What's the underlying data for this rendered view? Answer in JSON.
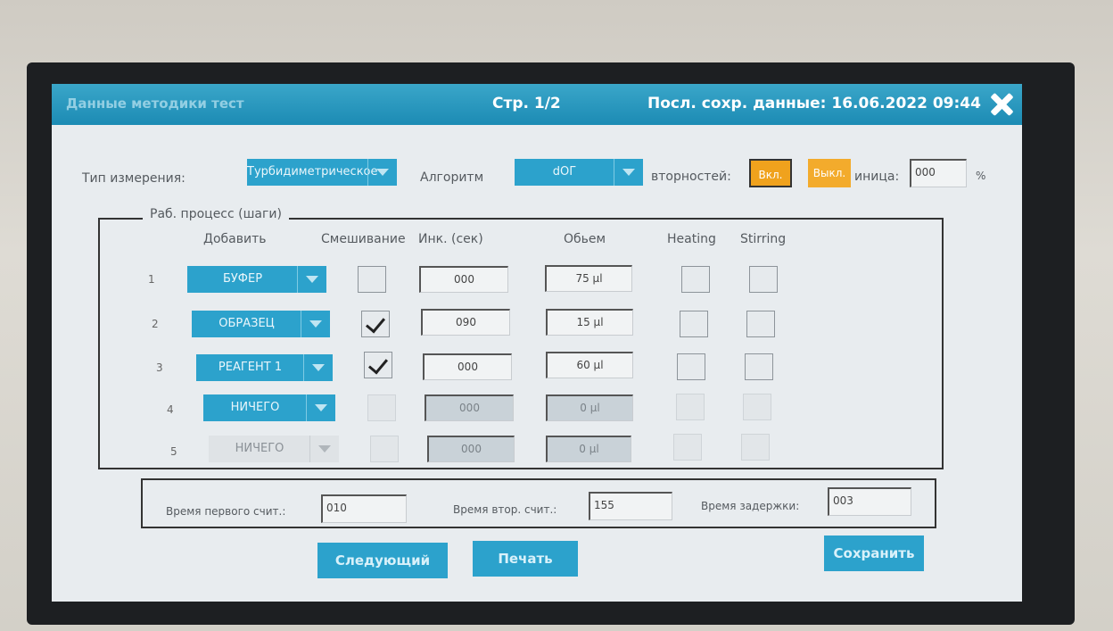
{
  "header": {
    "title": "Данные методики тест",
    "page": "Стр. 1/2",
    "last_saved": "Посл. сохр. данные: 16.06.2022 09:44"
  },
  "settings": {
    "measure_type_label": "Тип измерения:",
    "measure_type_value": "Турбидиметрическое",
    "algorithm_label": "Алгоритм",
    "algorithm_value": "dOГ",
    "repeats_label": "вторностей:",
    "on_label": "Вкл.",
    "off_label": "Выкл.",
    "unit_label": "иница:",
    "unit_value": "000",
    "percent": "%"
  },
  "workflow": {
    "title": "Раб. процесс (шаги)",
    "columns": {
      "add": "Добавить",
      "mix": "Смешивание",
      "inc": "Инк. (сек)",
      "volume": "Обьем",
      "heating": "Heating",
      "stirring": "Stirring"
    },
    "rows": [
      {
        "num": "1",
        "reagent": "БУФЕР",
        "inc": "000",
        "volume": "75 µl"
      },
      {
        "num": "2",
        "reagent": "ОБРАЗЕЦ",
        "inc": "090",
        "volume": "15 µl"
      },
      {
        "num": "3",
        "reagent": "РЕАГЕНТ 1",
        "inc": "000",
        "volume": "60 µl"
      },
      {
        "num": "4",
        "reagent": "НИЧЕГО",
        "inc": "000",
        "volume": "0 µl"
      },
      {
        "num": "5",
        "reagent": "НИЧЕГО",
        "inc": "000",
        "volume": "0 µl"
      }
    ]
  },
  "timing": {
    "first_label": "Время первого счит.:",
    "first_value": "010",
    "second_label": "Время втор. счит.:",
    "second_value": "155",
    "delay_label": "Время задержки:",
    "delay_value": "003"
  },
  "buttons": {
    "next": "Следующий",
    "print": "Печать",
    "save": "Сохранить"
  },
  "colors": {
    "accent": "#2ca2cc",
    "title_bar": "#1c8bb4",
    "toggle": "#f0a21d"
  }
}
